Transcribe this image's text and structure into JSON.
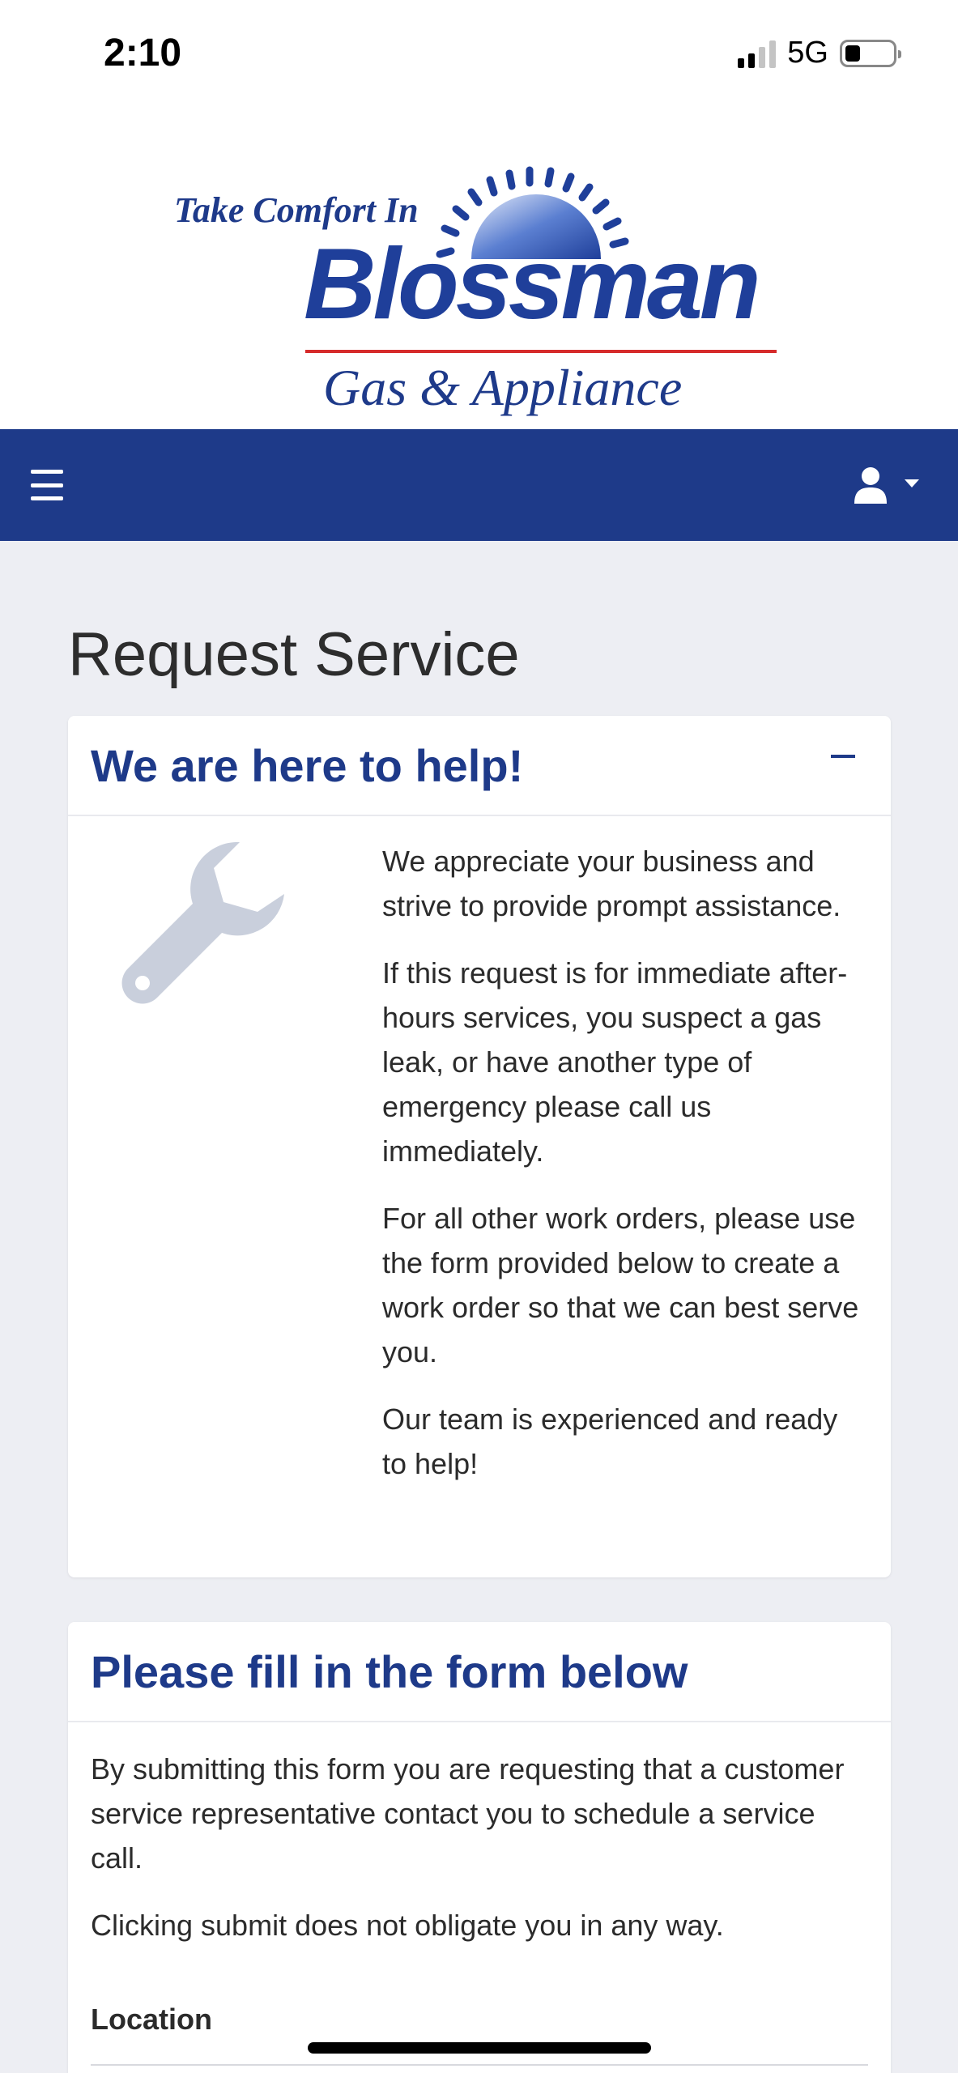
{
  "status_bar": {
    "time": "2:10",
    "network": "5G"
  },
  "logo": {
    "tagline": "Take Comfort In",
    "brand": "Blossman",
    "subtitle": "Gas & Appliance",
    "brand_color": "#1f3f9a",
    "accent_color": "#d62b2b"
  },
  "navbar": {
    "background": "#1e3a89",
    "menu_icon": "hamburger-icon",
    "user_icon": "user-icon"
  },
  "page": {
    "title": "Request Service"
  },
  "help_card": {
    "title": "We are here to help!",
    "collapse_icon": "minus-icon",
    "illustration_icon": "wrench-icon",
    "paragraphs": [
      "We appreciate your business and strive to provide prompt assistance.",
      "If this request is for immediate after-hours services, you suspect a gas leak, or have another type of emergency please call us immediately.",
      "For all other work orders, please use the form provided below to create a work order so that we can best serve you.",
      "Our team is experienced and ready to help!"
    ]
  },
  "form_card": {
    "title": "Please fill in the form below",
    "paragraphs": [
      "By submitting this form you are requesting that a customer service representative contact you to schedule a service call.",
      "Clicking submit does not obligate you in any way."
    ],
    "location_label": "Location"
  }
}
